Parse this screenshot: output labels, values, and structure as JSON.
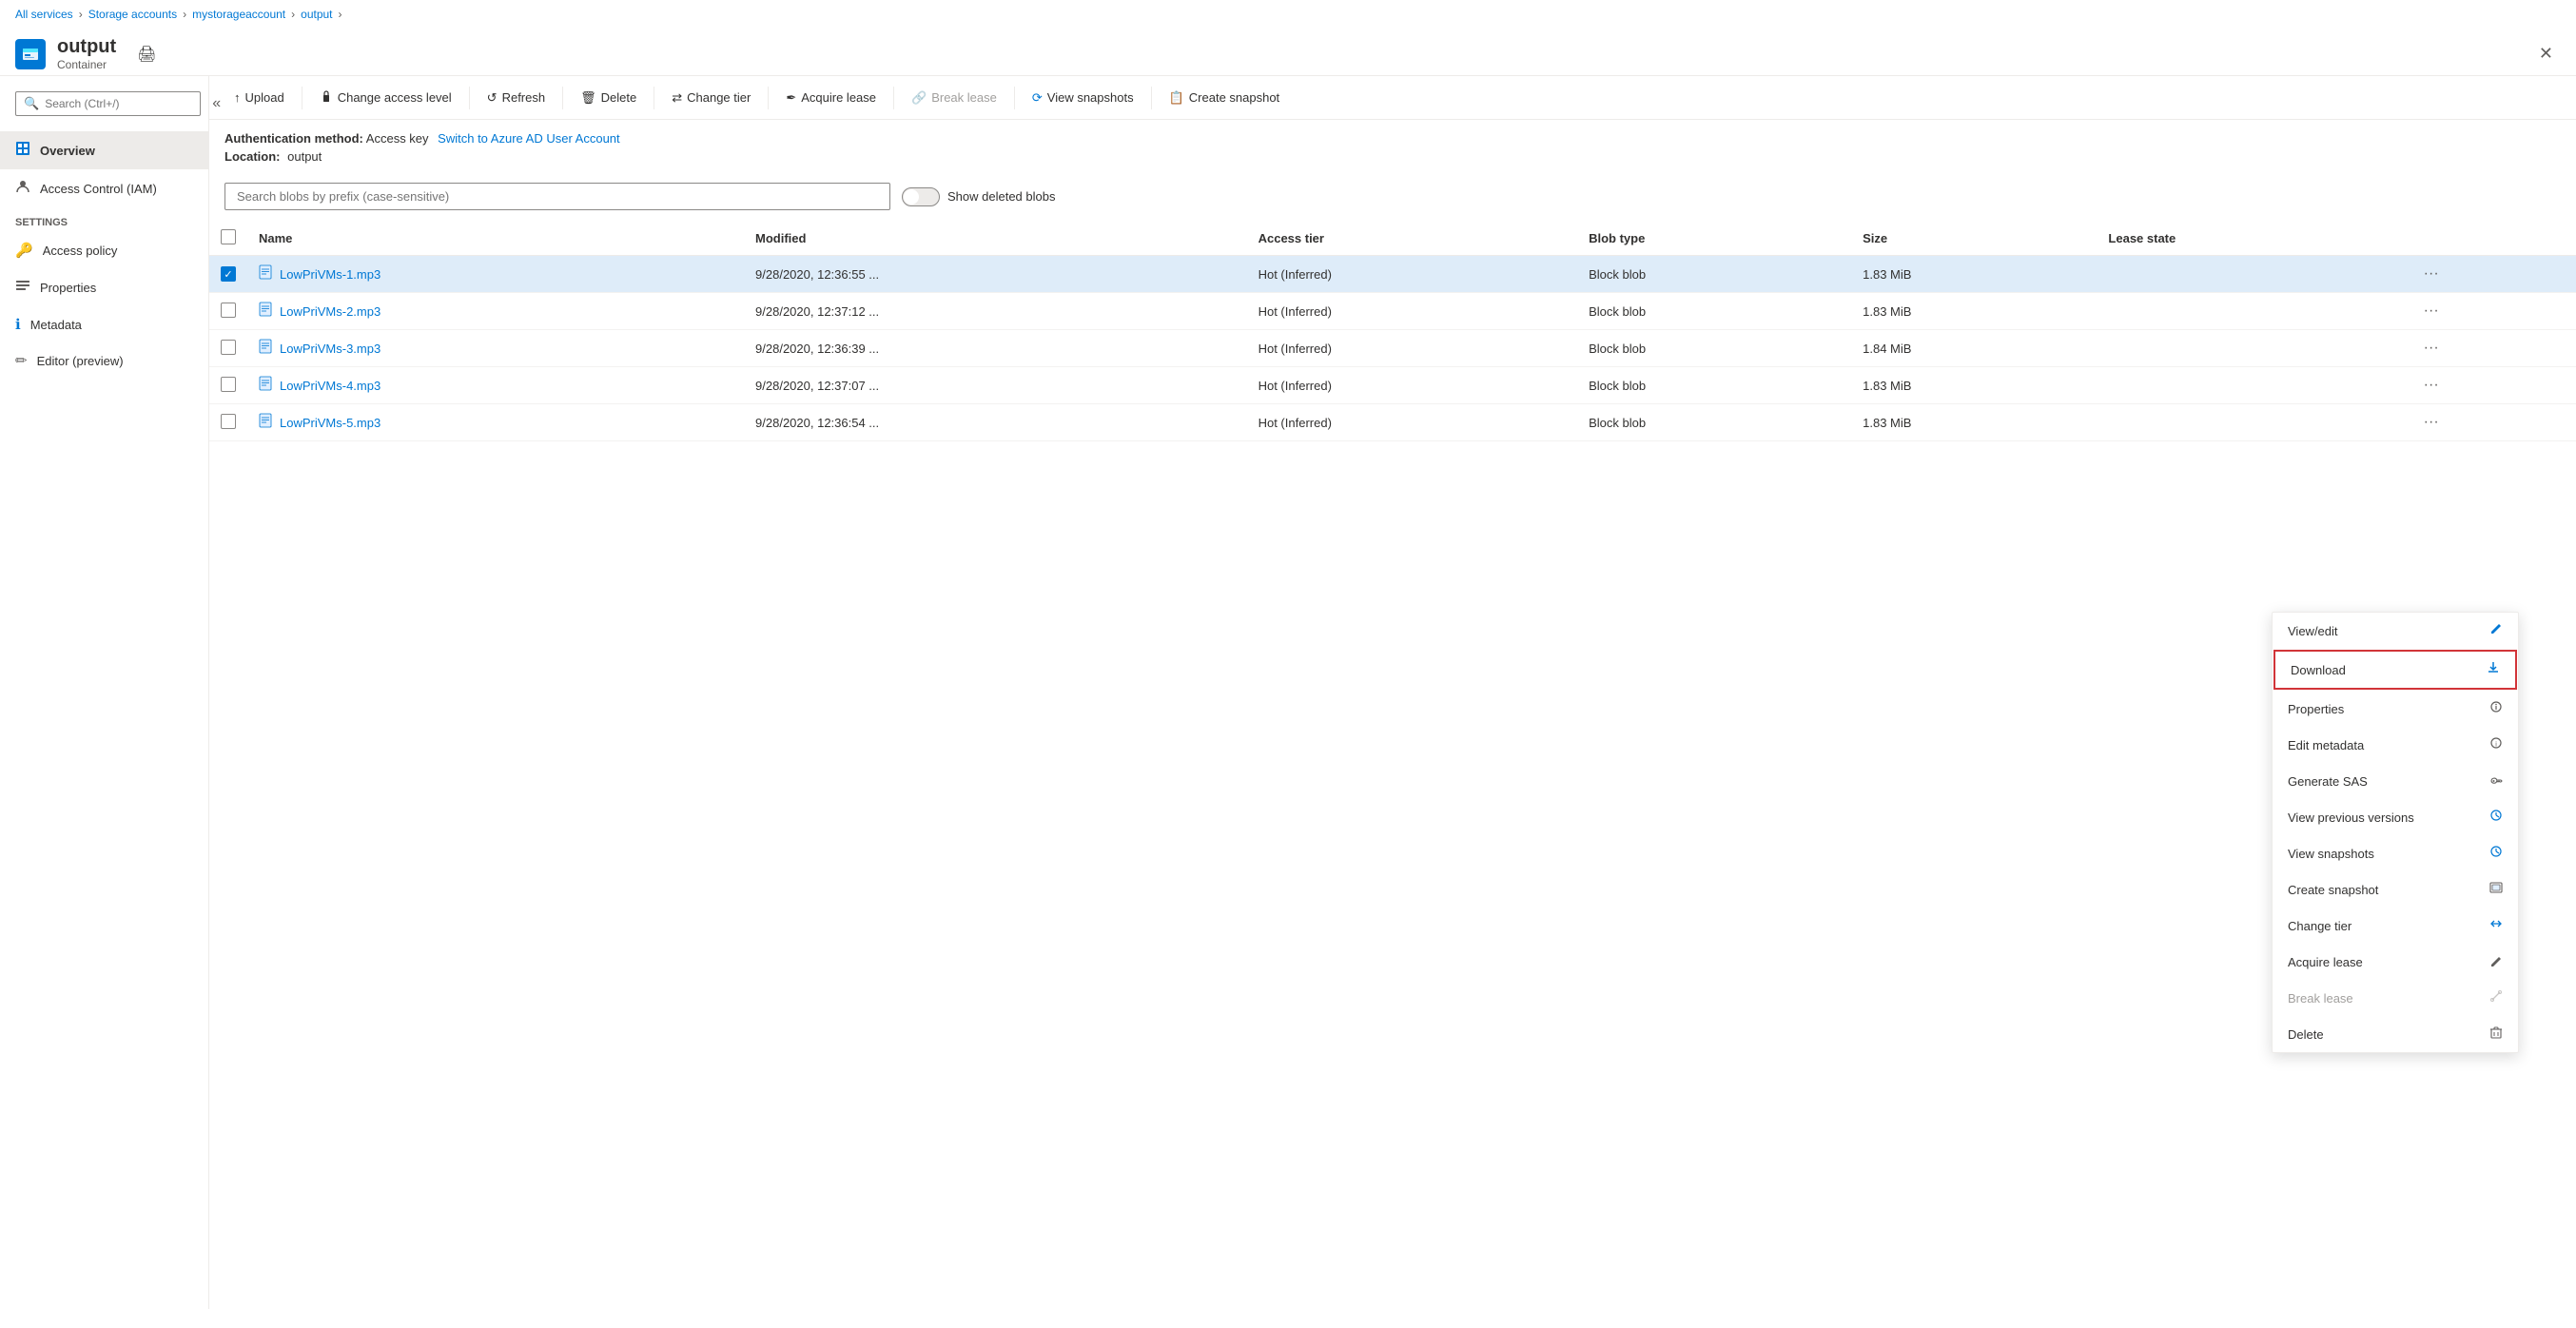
{
  "breadcrumb": {
    "items": [
      {
        "label": "All services",
        "href": "#"
      },
      {
        "label": "Storage accounts",
        "href": "#"
      },
      {
        "label": "mystorageaccount",
        "href": "#"
      },
      {
        "label": "output",
        "href": "#"
      }
    ]
  },
  "header": {
    "title": "output",
    "subtitle": "Container",
    "close_label": "✕",
    "print_icon": "🖨"
  },
  "sidebar": {
    "search_placeholder": "Search (Ctrl+/)",
    "nav_items": [
      {
        "id": "overview",
        "label": "Overview",
        "icon": "⬛",
        "active": true
      },
      {
        "id": "access-control",
        "label": "Access Control (IAM)",
        "icon": "👤"
      }
    ],
    "settings_label": "Settings",
    "settings_items": [
      {
        "id": "access-policy",
        "label": "Access policy",
        "icon": "🔑"
      },
      {
        "id": "properties",
        "label": "Properties",
        "icon": "📊"
      },
      {
        "id": "metadata",
        "label": "Metadata",
        "icon": "ℹ"
      },
      {
        "id": "editor",
        "label": "Editor (preview)",
        "icon": "✏"
      }
    ]
  },
  "toolbar": {
    "buttons": [
      {
        "id": "upload",
        "label": "Upload",
        "icon": "↑",
        "disabled": false
      },
      {
        "id": "change-access",
        "label": "Change access level",
        "icon": "🔒",
        "disabled": false
      },
      {
        "id": "refresh",
        "label": "Refresh",
        "icon": "↺",
        "disabled": false
      },
      {
        "id": "delete",
        "label": "Delete",
        "icon": "🗑",
        "disabled": false
      },
      {
        "id": "change-tier",
        "label": "Change tier",
        "icon": "↔",
        "disabled": false
      },
      {
        "id": "acquire-lease",
        "label": "Acquire lease",
        "icon": "✒",
        "disabled": false
      },
      {
        "id": "break-lease",
        "label": "Break lease",
        "icon": "🔗",
        "disabled": true
      },
      {
        "id": "view-snapshots",
        "label": "View snapshots",
        "icon": "🔵",
        "disabled": false
      },
      {
        "id": "create-snapshot",
        "label": "Create snapshot",
        "icon": "📋",
        "disabled": false
      }
    ]
  },
  "info_bar": {
    "auth_label": "Authentication method:",
    "auth_value": "Access key",
    "auth_link": "Switch to Azure AD User Account",
    "location_label": "Location:",
    "location_value": "output"
  },
  "search": {
    "placeholder": "Search blobs by prefix (case-sensitive)",
    "show_deleted_label": "Show deleted blobs"
  },
  "table": {
    "columns": [
      "",
      "Name",
      "Modified",
      "Access tier",
      "Blob type",
      "Size",
      "Lease state",
      ""
    ],
    "rows": [
      {
        "selected": true,
        "name": "LowPriVMs-1.mp3",
        "modified": "9/28/2020, 12:36:55 ...",
        "access_tier": "Hot (Inferred)",
        "blob_type": "Block blob",
        "size": "1.83 MiB",
        "lease_state": ""
      },
      {
        "selected": false,
        "name": "LowPriVMs-2.mp3",
        "modified": "9/28/2020, 12:37:12 ...",
        "access_tier": "Hot (Inferred)",
        "blob_type": "Block blob",
        "size": "1.83 MiB",
        "lease_state": ""
      },
      {
        "selected": false,
        "name": "LowPriVMs-3.mp3",
        "modified": "9/28/2020, 12:36:39 ...",
        "access_tier": "Hot (Inferred)",
        "blob_type": "Block blob",
        "size": "1.84 MiB",
        "lease_state": ""
      },
      {
        "selected": false,
        "name": "LowPriVMs-4.mp3",
        "modified": "9/28/2020, 12:37:07 ...",
        "access_tier": "Hot (Inferred)",
        "blob_type": "Block blob",
        "size": "1.83 MiB",
        "lease_state": ""
      },
      {
        "selected": false,
        "name": "LowPriVMs-5.mp3",
        "modified": "9/28/2020, 12:36:54 ...",
        "access_tier": "Hot (Inferred)",
        "blob_type": "Block blob",
        "size": "1.83 MiB",
        "lease_state": ""
      }
    ]
  },
  "context_menu": {
    "items": [
      {
        "id": "view-edit",
        "label": "View/edit",
        "icon": "✏",
        "disabled": false,
        "highlighted": false
      },
      {
        "id": "download",
        "label": "Download",
        "icon": "⬇",
        "disabled": false,
        "highlighted": true
      },
      {
        "id": "properties",
        "label": "Properties",
        "icon": "⚙",
        "disabled": false,
        "highlighted": false
      },
      {
        "id": "edit-metadata",
        "label": "Edit metadata",
        "icon": "ℹ",
        "disabled": false,
        "highlighted": false
      },
      {
        "id": "generate-sas",
        "label": "Generate SAS",
        "icon": "🔗",
        "disabled": false,
        "highlighted": false
      },
      {
        "id": "view-previous",
        "label": "View previous versions",
        "icon": "🔵",
        "disabled": false,
        "highlighted": false
      },
      {
        "id": "view-snapshots",
        "label": "View snapshots",
        "icon": "🔵",
        "disabled": false,
        "highlighted": false
      },
      {
        "id": "create-snapshot",
        "label": "Create snapshot",
        "icon": "📋",
        "disabled": false,
        "highlighted": false
      },
      {
        "id": "change-tier",
        "label": "Change tier",
        "icon": "↔",
        "disabled": false,
        "highlighted": false
      },
      {
        "id": "acquire-lease",
        "label": "Acquire lease",
        "icon": "✒",
        "disabled": false,
        "highlighted": false
      },
      {
        "id": "break-lease",
        "label": "Break lease",
        "icon": "🔗",
        "disabled": true,
        "highlighted": false
      },
      {
        "id": "delete",
        "label": "Delete",
        "icon": "🗑",
        "disabled": false,
        "highlighted": false
      }
    ]
  },
  "colors": {
    "accent": "#0078d4",
    "danger": "#d13438",
    "border": "#edebe9",
    "selected_bg": "#deecf9",
    "hover_bg": "#f3f2f1"
  }
}
